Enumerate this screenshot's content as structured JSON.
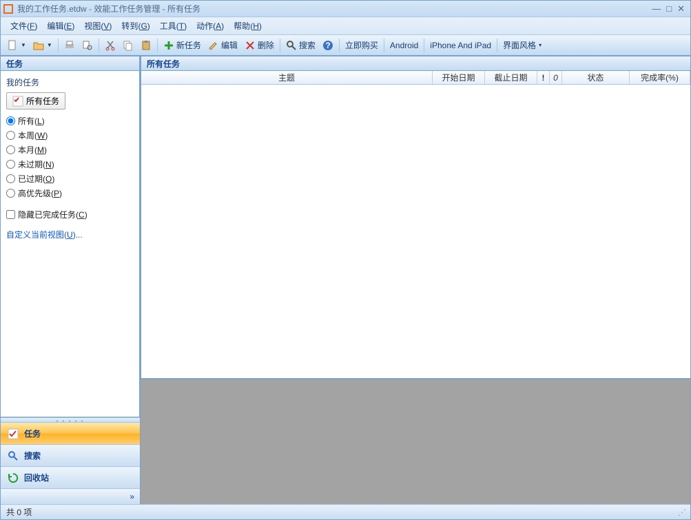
{
  "title": "我的工作任务.etdw - 效能工作任务管理 - 所有任务",
  "menubar": [
    {
      "label": "文件",
      "accel": "F"
    },
    {
      "label": "编辑",
      "accel": "E"
    },
    {
      "label": "视图",
      "accel": "V"
    },
    {
      "label": "转到",
      "accel": "G"
    },
    {
      "label": "工具",
      "accel": "T"
    },
    {
      "label": "动作",
      "accel": "A"
    },
    {
      "label": "帮助",
      "accel": "H"
    }
  ],
  "toolbar": {
    "new_task": "新任务",
    "edit": "编辑",
    "delete": "删除",
    "search": "搜索",
    "buy_now": "立即购买",
    "android": "Android",
    "iphone": "iPhone And iPad",
    "ui_style": "界面风格"
  },
  "sidebar": {
    "title": "任务",
    "my_tasks": "我的任务",
    "all_tasks_tab": "所有任务",
    "radios": [
      {
        "label": "所有",
        "accel": "L",
        "checked": true
      },
      {
        "label": "本周",
        "accel": "W",
        "checked": false
      },
      {
        "label": "本月",
        "accel": "M",
        "checked": false
      },
      {
        "label": "未过期",
        "accel": "N",
        "checked": false
      },
      {
        "label": "已过期",
        "accel": "O",
        "checked": false
      },
      {
        "label": "高优先级",
        "accel": "P",
        "checked": false
      }
    ],
    "hide_completed": {
      "label": "隐藏已完成任务",
      "accel": "C"
    },
    "custom_view": {
      "label": "自定义当前视图",
      "accel": "U",
      "suffix": "..."
    },
    "nav": {
      "tasks": "任务",
      "search": "搜索",
      "recycle": "回收站"
    }
  },
  "content": {
    "title": "所有任务",
    "columns": {
      "subject": "主题",
      "start_date": "开始日期",
      "end_date": "截止日期",
      "flag1": "!",
      "flag2": "0",
      "status": "状态",
      "complete_pct": "完成率(%)"
    }
  },
  "statusbar": {
    "text": "共 0 项"
  }
}
